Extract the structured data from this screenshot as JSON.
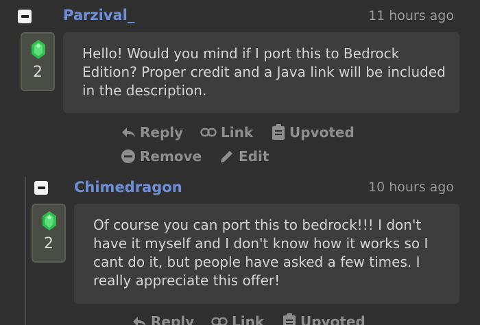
{
  "comments": [
    {
      "username": "Parzival_",
      "time": "11 hours ago",
      "votes": "2",
      "body": "Hello! Would you mind if I port this to Bedrock Edition? Proper credit and a Java link will be included in the description.",
      "actions": {
        "reply": "Reply",
        "link": "Link",
        "upvote": "Upvoted",
        "remove": "Remove",
        "edit": "Edit"
      }
    },
    {
      "username": "Chimedragon",
      "time": "10 hours ago",
      "votes": "2",
      "body": "Of course you can port this to bedrock!!! I don't have it myself and I don't know how it works so I cant do it, but people have asked a few times. I really appreciate this offer!",
      "actions": {
        "reply": "Reply",
        "link": "Link",
        "upvote": "Upvoted"
      }
    }
  ],
  "colors": {
    "username": "#6f8fd8",
    "background": "#303030",
    "comment_box": "#3d3d3d",
    "emerald": "#3ecf5c"
  },
  "icons": {
    "collapse": "minus-square-icon",
    "vote": "emerald-icon",
    "reply": "reply-arrow-icon",
    "link": "chain-link-icon",
    "upvote": "clipboard-icon",
    "remove": "minus-circle-icon",
    "edit": "pencil-icon"
  }
}
